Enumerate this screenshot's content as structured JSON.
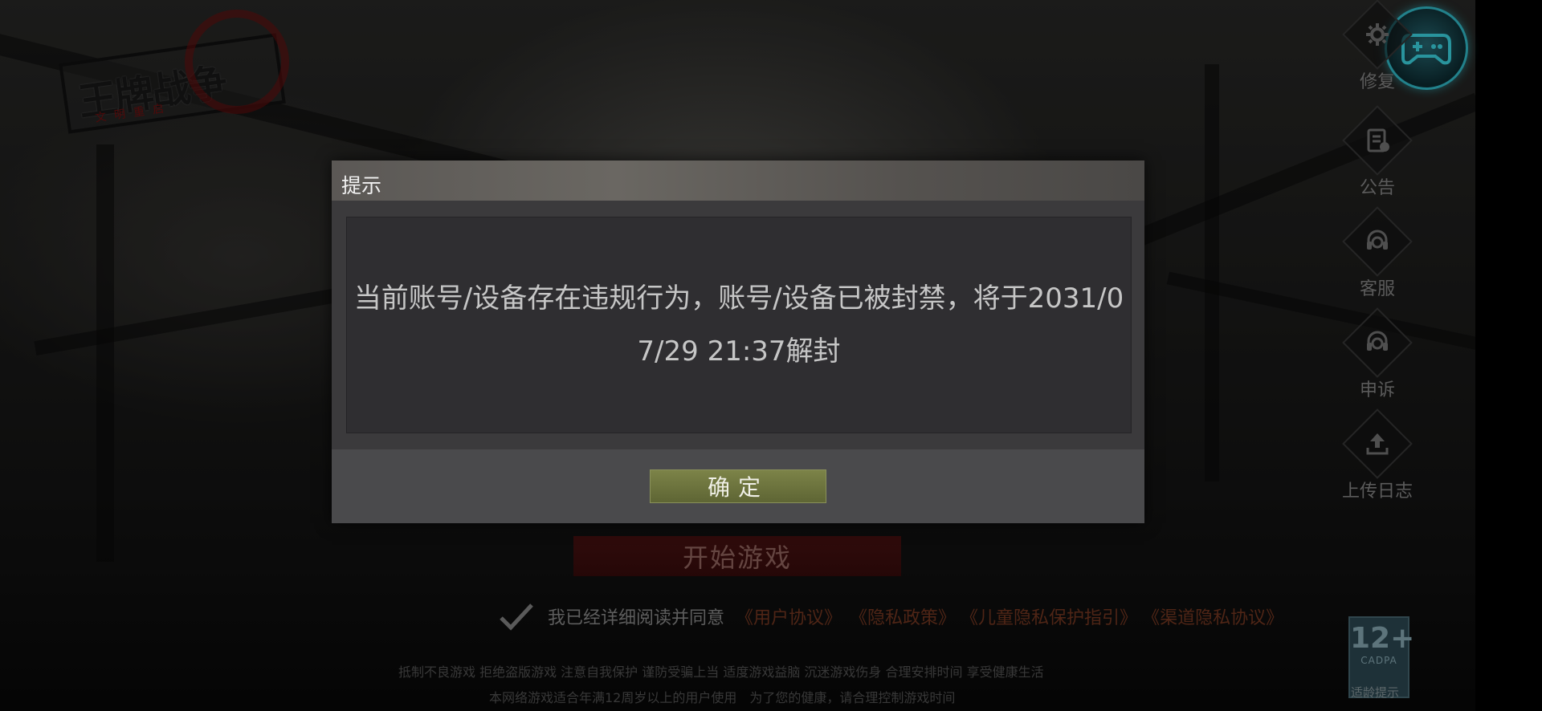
{
  "logo": {
    "text": "王牌战争",
    "subtitle": "文明重启"
  },
  "side_buttons": [
    {
      "label": "修复",
      "icon": "gear-icon"
    },
    {
      "label": "公告",
      "icon": "announcement-icon"
    },
    {
      "label": "客服",
      "icon": "headset-icon"
    },
    {
      "label": "申诉",
      "icon": "headset-icon"
    },
    {
      "label": "上传日志",
      "icon": "upload-icon"
    }
  ],
  "gamepad": {
    "icon": "gamepad-icon",
    "accent": "#35c6d6"
  },
  "start_button": "开始游戏",
  "agreement": {
    "checked": true,
    "text": "我已经详细阅读并同意",
    "links": [
      "《用户协议》",
      "《隐私政策》",
      "《儿童隐私保护指引》",
      "《渠道隐私协议》"
    ]
  },
  "footer": {
    "line1": "抵制不良游戏 拒绝盗版游戏 注意自我保护 谨防受骗上当 适度游戏益脑 沉迷游戏伤身 合理安排时间 享受健康生活",
    "line2": "本网络游戏适合年满12周岁以上的用户使用　为了您的健康，请合理控制游戏时间"
  },
  "age_rating": {
    "value": "12+",
    "org": "CADPA",
    "caption": "适龄提示"
  },
  "dialog": {
    "title": "提示",
    "message": "当前账号/设备存在违规行为，账号/设备已被封禁，将于2031/07/29 21:37解封",
    "ok_label": "确定"
  }
}
